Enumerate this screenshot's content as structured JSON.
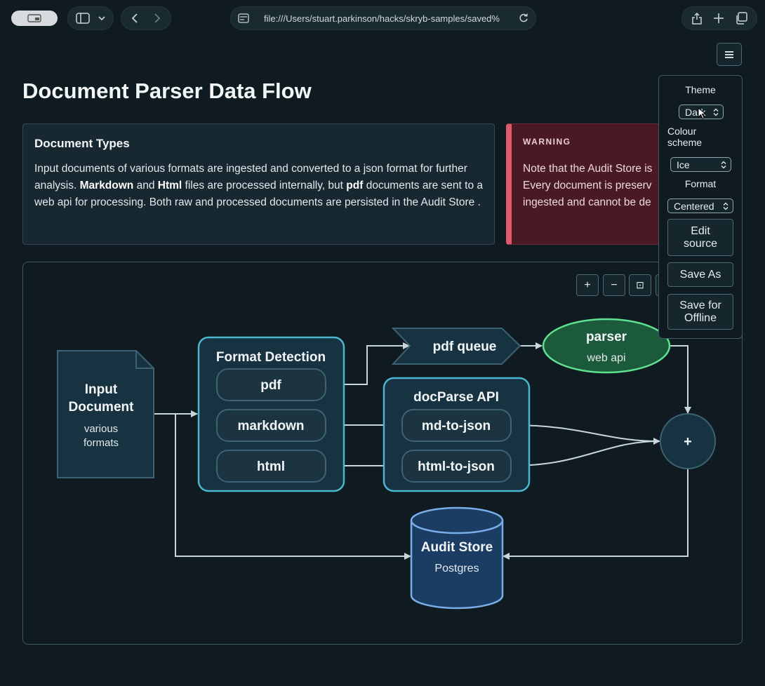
{
  "browser": {
    "url": "file:///Users/stuart.parkinson/hacks/skryb-samples/saved%"
  },
  "page": {
    "title": "Document Parser Data Flow",
    "menu_icon": "hamburger-icon"
  },
  "info": {
    "heading": "Document Types",
    "t1": "Input documents of various formats are ingested and converted to a json format for further analysis. ",
    "b1": "Markdown",
    "t2": " and ",
    "b2": "Html",
    "t3": " files are processed internally, but ",
    "b3": "pdf",
    "t4": " documents are sent to a web api for processing. Both raw and processed documents are persisted in the Audit Store ."
  },
  "warning": {
    "title": "WARNING",
    "line1": "Note that the Audit Store is",
    "line2": "Every document is preserv",
    "line3": "ingested and cannot be de"
  },
  "zoom": {
    "zoom_in": "+",
    "zoom_out": "−",
    "fit": "⊡"
  },
  "settings": {
    "theme_label": "Theme",
    "theme_value": "Dark",
    "colour_label_1": "Colour",
    "colour_label_2": "scheme",
    "colour_value": "Ice",
    "format_label": "Format",
    "format_value": "Centered",
    "edit_1": "Edit",
    "edit_2": "source",
    "save_as": "Save As",
    "offline_1": "Save for",
    "offline_2": "Offline"
  },
  "diagram": {
    "input_1": "Input",
    "input_2": "Document",
    "input_sub_1": "various",
    "input_sub_2": "formats",
    "format_detection": "Format Detection",
    "fd_pdf": "pdf",
    "fd_markdown": "markdown",
    "fd_html": "html",
    "pdf_queue": "pdf queue",
    "parser": "parser",
    "parser_sub": "web api",
    "docparse": "docParse API",
    "md_to_json": "md-to-json",
    "html_to_json": "html-to-json",
    "join": "+",
    "audit_store": "Audit Store",
    "audit_sub": "Postgres"
  },
  "colors": {
    "background": "#0f1b20",
    "node_fill": "#173240",
    "node_border": "#4bb6cf",
    "parser_fill": "#1b5a3a",
    "parser_border": "#5fe08f",
    "db_fill": "#1c3d63",
    "db_border": "#79aee8",
    "warning_accent": "#e05a6e"
  }
}
